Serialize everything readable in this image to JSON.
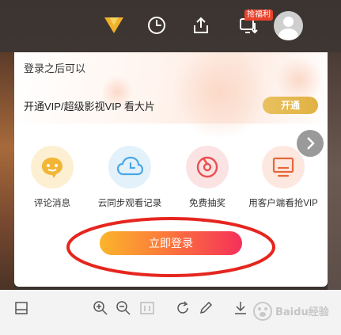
{
  "header": {
    "badge_label": "抢福利"
  },
  "panel": {
    "login_after_text": "登录之后可以",
    "vip_promo_text": "开通VIP/超级影视VIP 看大片",
    "open_button_label": "开通",
    "features": [
      {
        "label": "评论消息",
        "icon": "comment-bubble-icon",
        "bg": "#fdf0d2",
        "fg": "#f2b535"
      },
      {
        "label": "云同步观看记录",
        "icon": "cloud-clock-icon",
        "bg": "#e3f1fb",
        "fg": "#4aa6e3"
      },
      {
        "label": "免费抽奖",
        "icon": "lottery-icon",
        "bg": "#fbe3e3",
        "fg": "#e85050"
      },
      {
        "label": "用客户端看抢VIP",
        "icon": "monitor-icon",
        "bg": "#fde8e0",
        "fg": "#e8673a"
      }
    ],
    "login_button_label": "立即登录"
  },
  "colors": {
    "accent_gold": "#e6b84f",
    "annotation_red": "#e5261f"
  },
  "watermark": "Baidu经验"
}
